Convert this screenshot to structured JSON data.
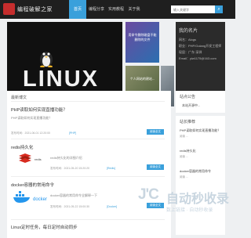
{
  "brand": {
    "name": "编程破解之家"
  },
  "nav": [
    {
      "label": "首页",
      "active": true
    },
    {
      "label": "编程分享",
      "active": false
    },
    {
      "label": "实用教程",
      "active": false
    },
    {
      "label": "关于我",
      "active": false
    }
  ],
  "search": {
    "placeholder": "输入关键字"
  },
  "hero": {
    "word": "LINUX"
  },
  "thumbs": [
    {
      "caption": "用命令删除磁盘不能删除的文件"
    },
    {
      "caption": "个人网站的建站..."
    },
    {
      "caption": ""
    }
  ],
  "profile": {
    "title": "我的名片",
    "lines": [
      "网名：Alogs",
      "职业：PHP/Golang开发工程师",
      "现居：广东·深圳",
      "Email：yiw1175@163.com"
    ]
  },
  "posts_panel": {
    "title": "最新博文"
  },
  "posts": [
    {
      "title": "PHP读取如何实现直播功能？",
      "text": "PHP读取如何实现直播功能？",
      "meta": "发布时间：2021-06-01 12:20:00",
      "tag": "[PHP]",
      "readmore": "阅读全文"
    },
    {
      "title": "redis持久化",
      "text": "redis持久化的详细介绍",
      "meta": "发布时间：2021-05-20 15:20:20",
      "tag": "[Redis]",
      "readmore": "阅读全文"
    },
    {
      "title": "docker容器的常用命令",
      "text": "docker容器的常用命令全解释一下",
      "meta": "发布时间：2021-05-22 15:00:30",
      "tag": "[Docker]",
      "readmore": "阅读全文"
    },
    {
      "title": "Linux定时任务，每日定时自动同步"
    }
  ],
  "side1": {
    "title": "站点公告",
    "items": [
      "本站开源中..."
    ]
  },
  "side2": {
    "title": "站长推荐",
    "items": [
      {
        "text": "PHP读取如何实现直播功能？",
        "meta": "阅读 ..."
      },
      {
        "text": "redis持久化",
        "meta": "阅读 ..."
      },
      {
        "text": "docker容器的常用命令",
        "meta": "阅读 ..."
      }
    ]
  },
  "watermark": {
    "logo": "J'C",
    "title": "自动秒收录",
    "sub": "数上链接 · 自动秒收录"
  },
  "colors": {
    "accent": "#3aa0db",
    "topbar": "#1f1f1f",
    "profile_bg": "#2b2b2b"
  }
}
